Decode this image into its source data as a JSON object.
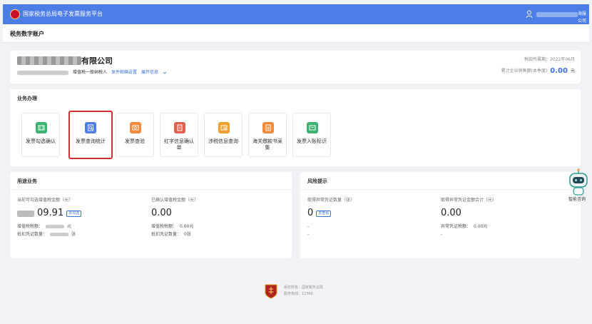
{
  "topbar": {
    "title": "国家税务总局电子发票服务平台",
    "user_suffix": "海服公司"
  },
  "breadcrumb": "税务数字账户",
  "company": {
    "name_suffix": "有限公司",
    "taxpayer_type": "增值税一般纳税人",
    "link_email": "发件邮箱设置",
    "link_more": "展开信息",
    "period_label": "税款所属期：",
    "period_value": "2022年06月",
    "amount_label": "累计企业销售额(本季度)",
    "amount_value": "0.00",
    "amount_unit": "元"
  },
  "business": {
    "title": "业务办理",
    "tiles": [
      {
        "label": "发票勾选确认",
        "color": "#3cb371",
        "icon": "invoice-check-icon"
      },
      {
        "label": "发票查询统计",
        "color": "#4d7ee8",
        "icon": "invoice-search-icon"
      },
      {
        "label": "发票查验",
        "color": "#f08a3c",
        "icon": "invoice-verify-icon"
      },
      {
        "label": "红字信息确认单",
        "color": "#e06050",
        "icon": "red-letter-icon"
      },
      {
        "label": "涉税信息查询",
        "color": "#f0a030",
        "icon": "tax-info-icon"
      },
      {
        "label": "海关缴款书采集",
        "color": "#f08a3c",
        "icon": "customs-icon"
      },
      {
        "label": "发票入账标识",
        "color": "#3cb371",
        "icon": "invoice-mark-icon"
      }
    ]
  },
  "usage": {
    "title": "用途业务",
    "c1_label": "当前可勾选增值税金额（元）",
    "c1_value": "09.91",
    "c1_badge": "去勾选",
    "c1_tax_label": "增值税税额：",
    "c1_tax_unit": "元",
    "c1_count_label": "抵扣凭证数量：",
    "c1_count_unit": "张",
    "c2_label": "已确认增值税金额（元）",
    "c2_value": "0.00",
    "c2_tax_label": "增值税税额：",
    "c2_tax_value": "0.00元",
    "c2_count_label": "抵扣凭证数量：",
    "c2_count_value": "0张"
  },
  "risk": {
    "title": "风险提示",
    "c1_label": "取得异常凭证数量（张）",
    "c1_value": "0",
    "c1_badge": "去查看",
    "c1_dash1": "-",
    "c1_dash2": "-",
    "c2_label": "取得异常凭证金额合计（元）",
    "c2_value": "0.00",
    "c2_tax_label": "异常凭证税额：",
    "c2_tax_value": "0.00元",
    "c2_dash": "-"
  },
  "assistant": {
    "label": "智能咨询"
  },
  "footer": {
    "line1": "版权所有：国家税务总局",
    "line2": "服务热线：12366"
  }
}
